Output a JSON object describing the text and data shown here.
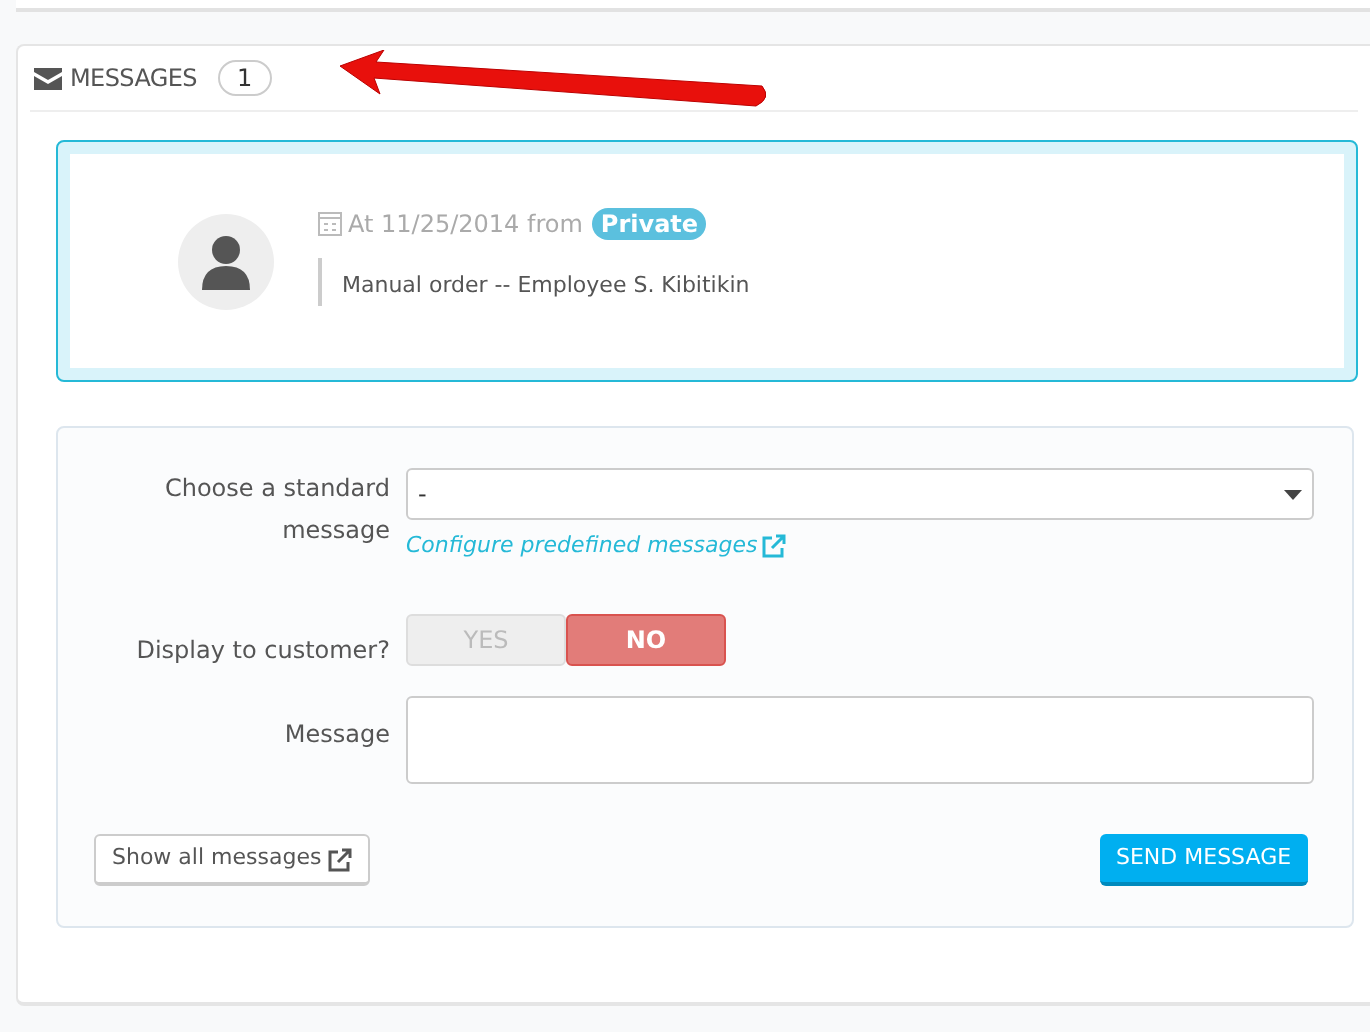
{
  "panel": {
    "title": "MESSAGES",
    "count": "1"
  },
  "message": {
    "date_text": "At 11/25/2014 from",
    "badge": "Private",
    "body": "Manual order -- Employee S. Kibitikin"
  },
  "form": {
    "standard_message": {
      "label": "Choose a standard message",
      "value": "-"
    },
    "configure_link": "Configure predefined messages",
    "display_to_customer": {
      "label": "Display to customer?",
      "options": [
        {
          "label": "YES",
          "selected": false
        },
        {
          "label": "NO",
          "selected": true
        }
      ]
    },
    "message": {
      "label": "Message"
    },
    "show_all_button": "Show all messages",
    "send_button": "SEND MESSAGE"
  }
}
